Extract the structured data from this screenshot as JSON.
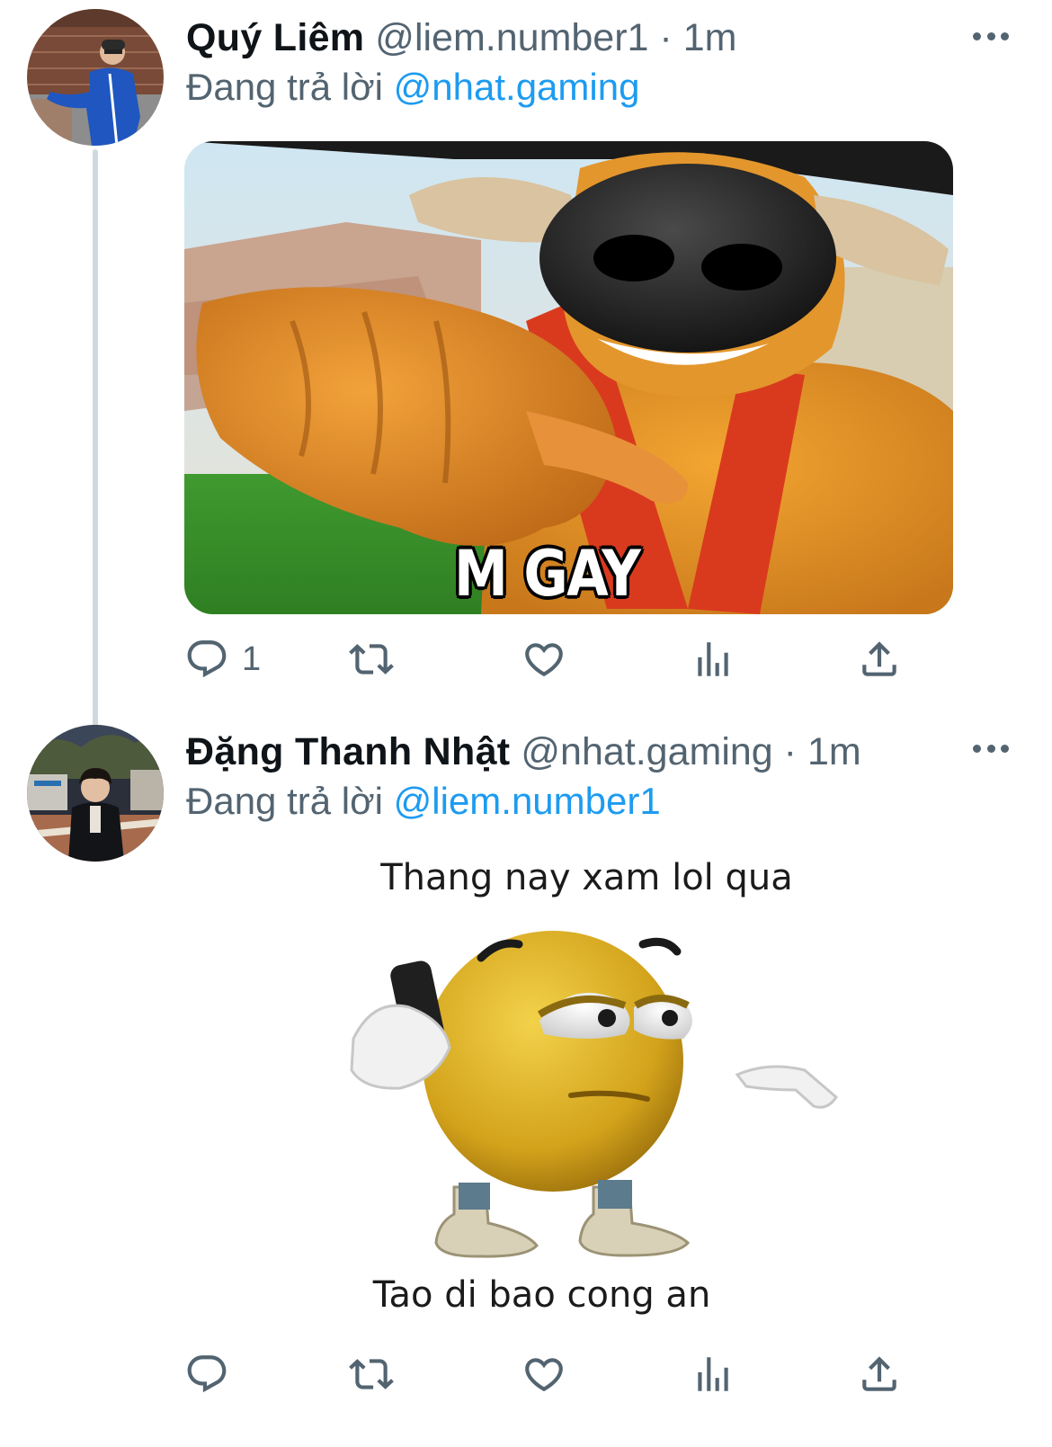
{
  "tweets": [
    {
      "display_name": "Quý Liêm",
      "handle": "@liem.number1",
      "separator": "·",
      "time": "1m",
      "reply_prefix": "Đang trả lời",
      "reply_to": "@nhat.gaming",
      "media_text": "M GAY",
      "reply_count": "1"
    },
    {
      "display_name": "Đặng Thanh Nhật",
      "handle": "@nhat.gaming",
      "separator": "·",
      "time": "1m",
      "reply_prefix": "Đang trả lời",
      "reply_to": "@liem.number1",
      "media_caption_top": "Thang nay xam lol qua",
      "media_caption_bottom": "Tao di bao cong an",
      "reply_count": ""
    }
  ],
  "colors": {
    "text": "#0f1419",
    "secondary": "#536471",
    "link": "#1d9bf0",
    "thread_line": "#cfd9de"
  },
  "icons": [
    "more-icon",
    "reply-icon",
    "retweet-icon",
    "like-icon",
    "views-icon",
    "share-icon"
  ]
}
